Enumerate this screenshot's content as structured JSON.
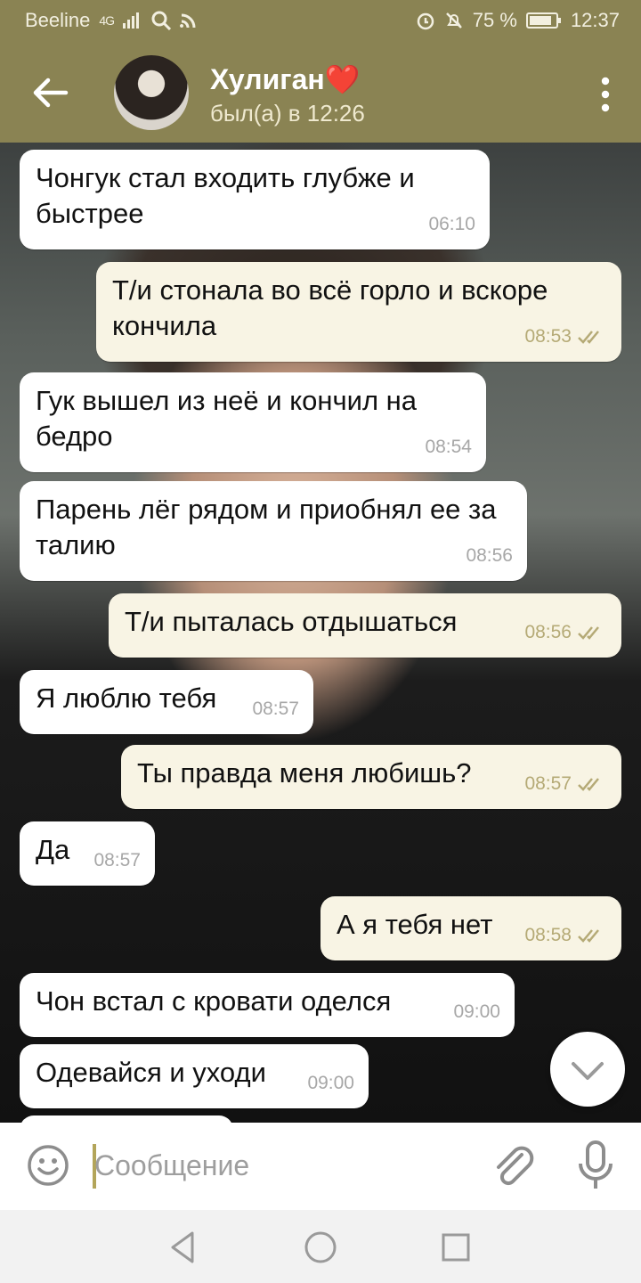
{
  "status_bar": {
    "carrier": "Beeline",
    "network": "4G",
    "battery": "75 %",
    "time": "12:37"
  },
  "header": {
    "title": "Хулиган",
    "title_emoji": "❤️",
    "status": "был(а) в 12:26"
  },
  "colors": {
    "header": "#8a8353",
    "incoming": "#ffffff",
    "outgoing": "#f8f4e4",
    "read_check": "#b5aa76"
  },
  "messages": [
    {
      "text": "Чонгук стал входить глубже и быстрее",
      "time": "06:10",
      "direction": "in"
    },
    {
      "text": "Т/и стонала во всё горло и вскоре кончила",
      "time": "08:53",
      "direction": "out",
      "read": true
    },
    {
      "text": "Гук вышел из неё и кончил на бедро",
      "time": "08:54",
      "direction": "in"
    },
    {
      "text": "Парень лёг рядом и приобнял ее за талию",
      "time": "08:56",
      "direction": "in"
    },
    {
      "text": "Т/и пыталась отдышаться",
      "time": "08:56",
      "direction": "out",
      "read": true
    },
    {
      "text": "Я люблю тебя",
      "time": "08:57",
      "direction": "in"
    },
    {
      "text": "Ты правда меня любишь?",
      "time": "08:57",
      "direction": "out",
      "read": true
    },
    {
      "text": "Да",
      "time": "08:57",
      "direction": "in"
    },
    {
      "text": "А я тебя нет",
      "time": "08:58",
      "direction": "out",
      "read": true
    },
    {
      "text": "Чон встал с кровати оделся",
      "time": "09:00",
      "direction": "in"
    },
    {
      "text": "Одевайся и уходи",
      "time": "09:00",
      "direction": "in"
    }
  ],
  "input": {
    "placeholder": "Сообщение"
  },
  "icons": {
    "back": "arrow-left-icon",
    "menu": "kebab-menu-icon",
    "emoji": "smiley-icon",
    "attach": "paperclip-icon",
    "voice": "microphone-icon",
    "scroll": "chevron-down-icon"
  }
}
